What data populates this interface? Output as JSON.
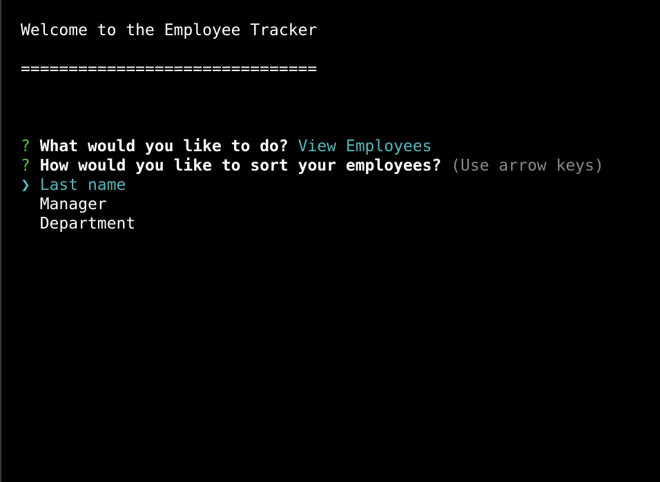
{
  "terminal": {
    "welcome": "Welcome to the Employee Tracker",
    "divider": "===============================",
    "prompt1": {
      "marker": "?",
      "question": "What would you like to do?",
      "answer": "View Employees"
    },
    "prompt2": {
      "marker": "?",
      "question": "How would you like to sort your employees?",
      "hint": "(Use arrow keys)"
    },
    "pointer": "❯",
    "options": [
      "Last name",
      "Manager",
      "Department"
    ],
    "selected_index": 0
  },
  "colors": {
    "background": "#000000",
    "prompt_marker": "#5fbf3a",
    "answer": "#58b6bc",
    "hint": "#8a8a8a",
    "text": "#ffffff"
  }
}
